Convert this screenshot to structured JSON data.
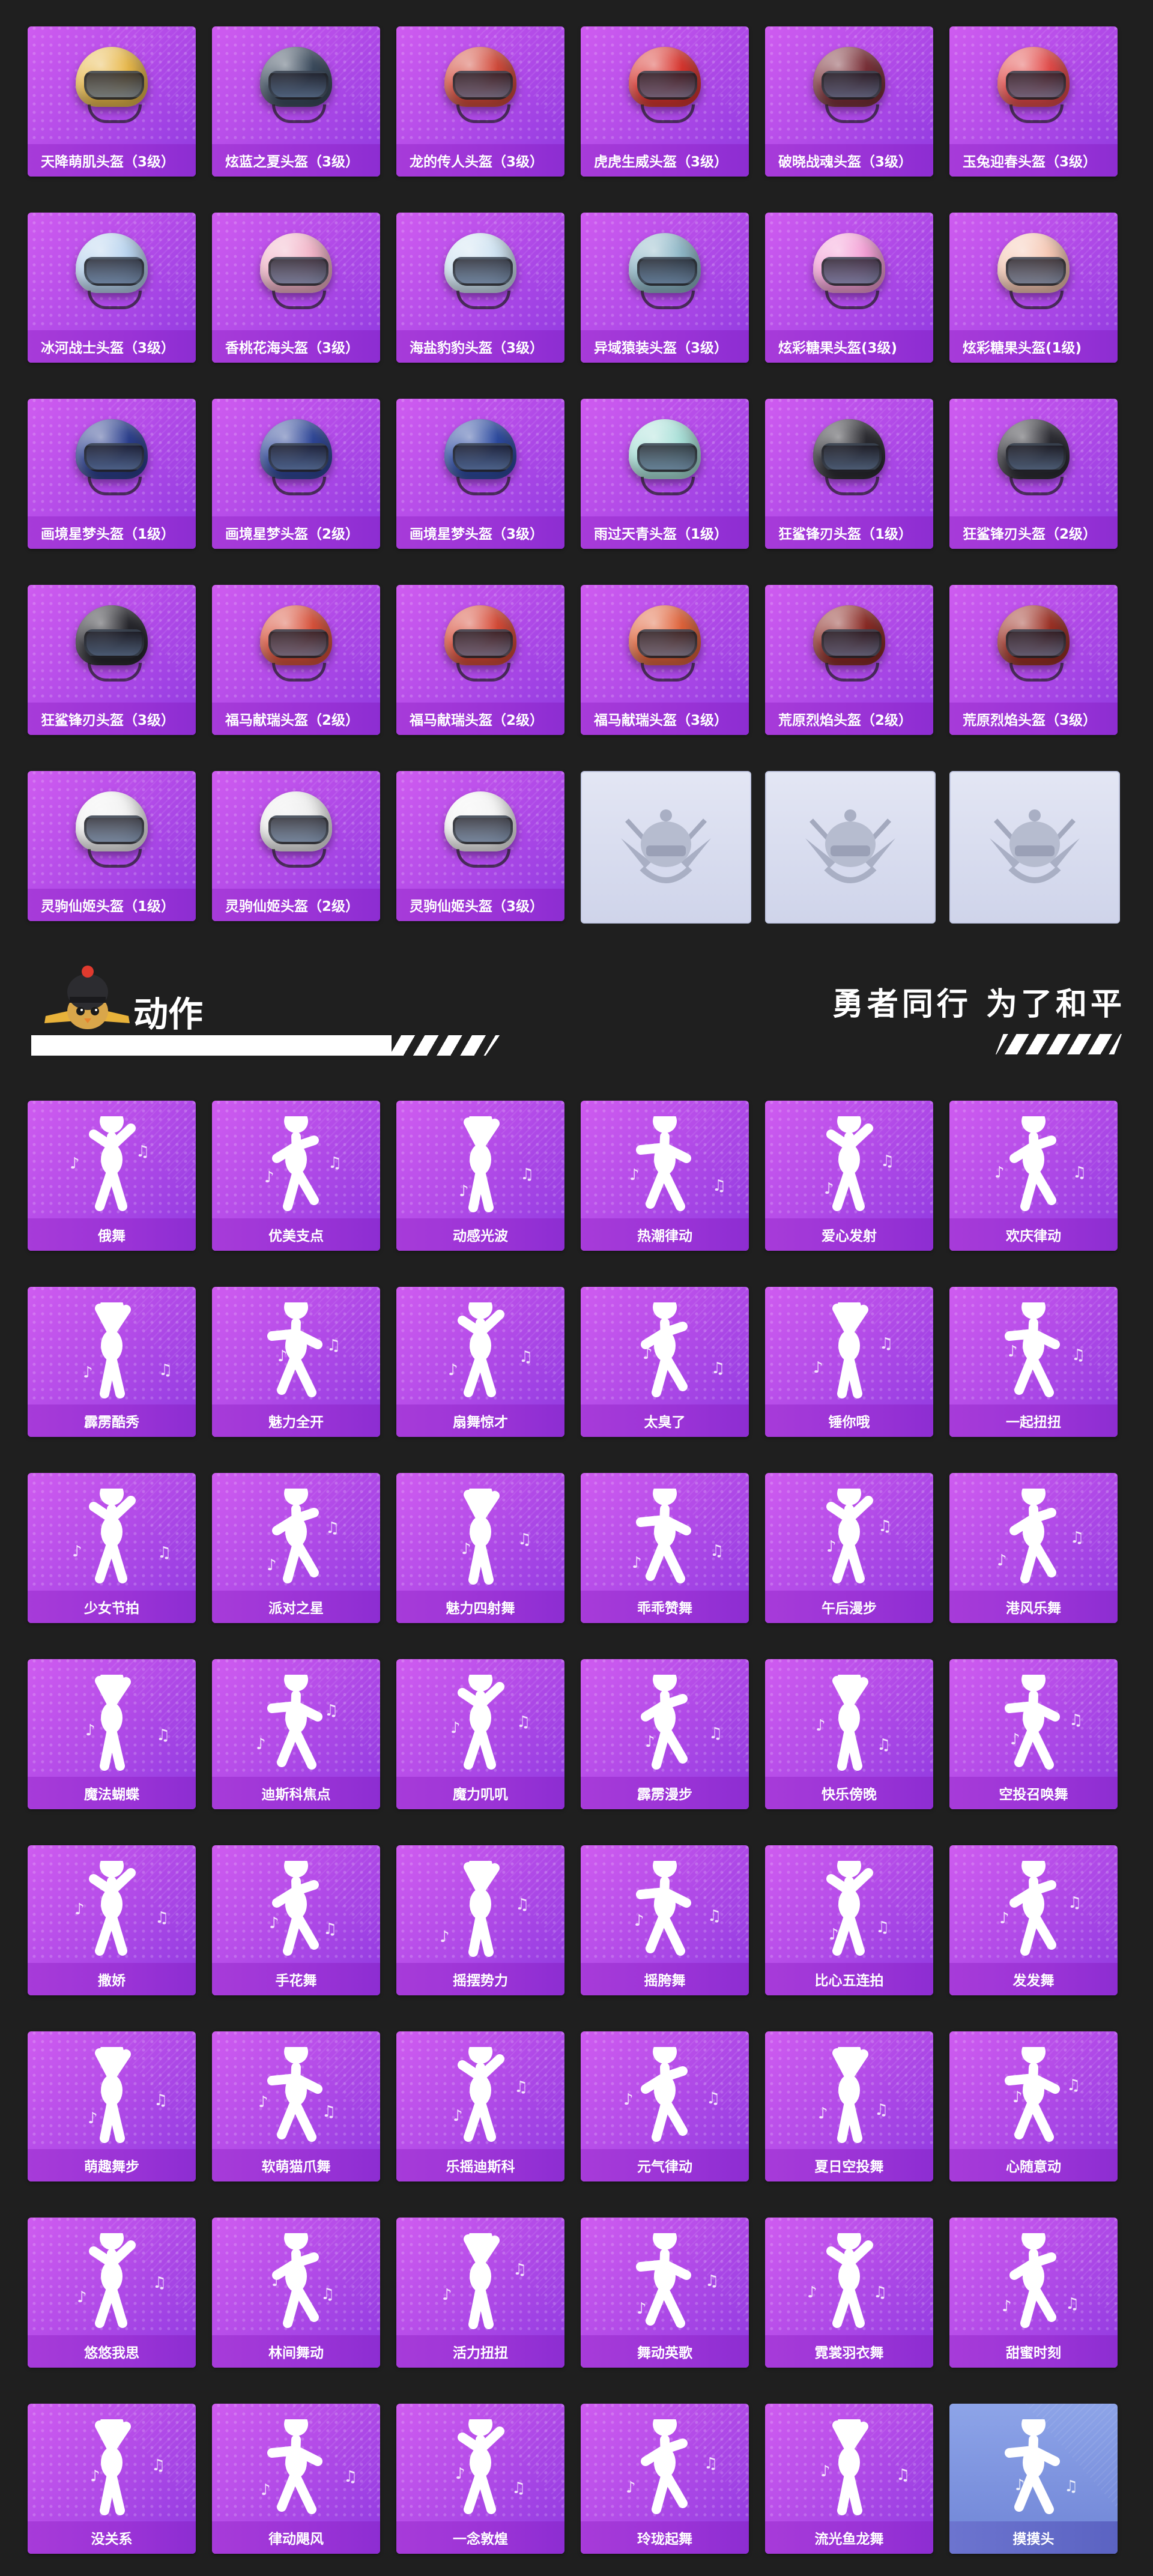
{
  "helmets": [
    {
      "label": "天降萌肌头盔（3级）",
      "color": "#e8b84a"
    },
    {
      "label": "炫蓝之夏头盔（3级）",
      "color": "#3a4a5c"
    },
    {
      "label": "龙的传人头盔（3级）",
      "color": "#d24a3a"
    },
    {
      "label": "虎虎生威头盔（3级）",
      "color": "#d8352e"
    },
    {
      "label": "破晓战魂头盔（3级）",
      "color": "#7a3038"
    },
    {
      "label": "玉兔迎春头盔（3级）",
      "color": "#e24a48"
    },
    {
      "label": "冰河战士头盔（3级）",
      "color": "#b9d4ef"
    },
    {
      "label": "香桃花海头盔（3级）",
      "color": "#f2b4c8"
    },
    {
      "label": "海盐豹豹头盔（3级）",
      "color": "#cfe3f2"
    },
    {
      "label": "异域猿装头盔（3级）",
      "color": "#8fb8c8"
    },
    {
      "label": "炫彩糖果头盔(3级)",
      "color": "#f4a0d6"
    },
    {
      "label": "炫彩糖果头盔(1级)",
      "color": "#f6c8b4"
    },
    {
      "label": "画境星梦头盔（1级）",
      "color": "#2b3f8e"
    },
    {
      "label": "画境星梦头盔（2级）",
      "color": "#2e4698"
    },
    {
      "label": "画境星梦头盔（3级）",
      "color": "#2c4aa0"
    },
    {
      "label": "雨过天青头盔（1级）",
      "color": "#a8e0d8"
    },
    {
      "label": "狂鲨锋刃头盔（1级）",
      "color": "#2a2a30"
    },
    {
      "label": "狂鲨锋刃头盔（2级）",
      "color": "#2b2b32"
    },
    {
      "label": "狂鲨锋刃头盔（3级）",
      "color": "#26262c"
    },
    {
      "label": "福马献瑞头盔（2级）",
      "color": "#d8513a"
    },
    {
      "label": "福马献瑞头盔（2级）",
      "color": "#d64a36"
    },
    {
      "label": "福马献瑞头盔（3级）",
      "color": "#e0633a"
    },
    {
      "label": "荒原烈焰头盔（2级）",
      "color": "#8a2a24"
    },
    {
      "label": "荒原烈焰头盔（3级）",
      "color": "#9c3024"
    },
    {
      "label": "灵驹仙姬头盔（1级）",
      "color": "#f2f2f2"
    },
    {
      "label": "灵驹仙姬头盔（2级）",
      "color": "#eeeeee"
    },
    {
      "label": "灵驹仙姬头盔（3级）",
      "color": "#f4f4f4"
    }
  ],
  "locked_count": 3,
  "section": {
    "title": "动作",
    "slogan": "勇者同行 为了和平"
  },
  "emotes": [
    "俄舞",
    "优美支点",
    "动感光波",
    "热潮律动",
    "爱心发射",
    "欢庆律动",
    "霹雳酷秀",
    "魅力全开",
    "扇舞惊才",
    "太臭了",
    "锤你哦",
    "一起扭扭",
    "少女节拍",
    "派对之星",
    "魅力四射舞",
    "乖乖赞舞",
    "午后漫步",
    "港风乐舞",
    "魔法蝴蝶",
    "迪斯科焦点",
    "魔力叽叽",
    "霹雳漫步",
    "快乐傍晚",
    "空投召唤舞",
    "撒娇",
    "手花舞",
    "摇摆势力",
    "摇胯舞",
    "比心五连拍",
    "发发舞",
    "萌趣舞步",
    "软萌猫爪舞",
    "乐摇迪斯科",
    "元气律动",
    "夏日空投舞",
    "心随意动",
    "悠悠我思",
    "林间舞动",
    "活力扭扭",
    "舞动英歌",
    "霓裳羽衣舞",
    "甜蜜时刻",
    "没关系",
    "律动飓风",
    "一念敦煌",
    "玲珑起舞",
    "流光鱼龙舞",
    "摸摸头"
  ]
}
